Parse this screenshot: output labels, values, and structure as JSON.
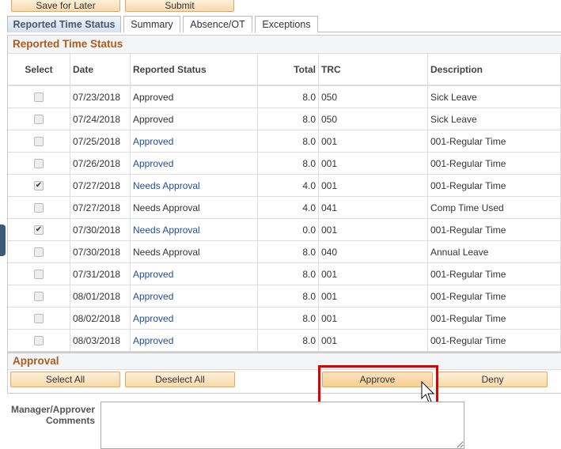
{
  "top_buttons": {
    "save": "Save for Later",
    "submit": "Submit"
  },
  "tabs": [
    {
      "label": "Reported Time Status",
      "active": true
    },
    {
      "label": "Summary"
    },
    {
      "label": "Absence/OT"
    },
    {
      "label": "Exceptions"
    }
  ],
  "grid": {
    "title": "Reported Time Status",
    "columns": [
      "Select",
      "Date",
      "Reported Status",
      "Total",
      "TRC",
      "Description"
    ],
    "rows": [
      {
        "checked": false,
        "date": "07/23/2018",
        "status": "Approved",
        "link": false,
        "total": "8.0",
        "trc": "050",
        "desc": "Sick Leave"
      },
      {
        "checked": false,
        "date": "07/24/2018",
        "status": "Approved",
        "link": false,
        "total": "8.0",
        "trc": "050",
        "desc": "Sick Leave"
      },
      {
        "checked": false,
        "date": "07/25/2018",
        "status": "Approved",
        "link": true,
        "total": "8.0",
        "trc": "001",
        "desc": "001-Regular Time"
      },
      {
        "checked": false,
        "date": "07/26/2018",
        "status": "Approved",
        "link": true,
        "total": "8.0",
        "trc": "001",
        "desc": "001-Regular Time"
      },
      {
        "checked": true,
        "date": "07/27/2018",
        "status": "Needs Approval",
        "link": true,
        "total": "4.0",
        "trc": "001",
        "desc": "001-Regular Time"
      },
      {
        "checked": false,
        "date": "07/27/2018",
        "status": "Needs Approval",
        "link": false,
        "total": "4.0",
        "trc": "041",
        "desc": "Comp Time Used"
      },
      {
        "checked": true,
        "date": "07/30/2018",
        "status": "Needs Approval",
        "link": true,
        "total": "0.0",
        "trc": "001",
        "desc": "001-Regular Time"
      },
      {
        "checked": false,
        "date": "07/30/2018",
        "status": "Needs Approval",
        "link": false,
        "total": "8.0",
        "trc": "040",
        "desc": "Annual Leave"
      },
      {
        "checked": false,
        "date": "07/31/2018",
        "status": "Approved",
        "link": true,
        "total": "8.0",
        "trc": "001",
        "desc": "001-Regular Time"
      },
      {
        "checked": false,
        "date": "08/01/2018",
        "status": "Approved",
        "link": true,
        "total": "8.0",
        "trc": "001",
        "desc": "001-Regular Time"
      },
      {
        "checked": false,
        "date": "08/02/2018",
        "status": "Approved",
        "link": true,
        "total": "8.0",
        "trc": "001",
        "desc": "001-Regular Time"
      },
      {
        "checked": false,
        "date": "08/03/2018",
        "status": "Approved",
        "link": true,
        "total": "8.0",
        "trc": "001",
        "desc": "001-Regular Time"
      }
    ]
  },
  "approval": {
    "title": "Approval",
    "select_all": "Select All",
    "deselect_all": "Deselect All",
    "approve": "Approve",
    "deny": "Deny"
  },
  "comments": {
    "label1": "Manager/Approver",
    "label2": "Comments",
    "value": ""
  },
  "colors": {
    "highlight": "#e00000",
    "section_title": "#b05a1c",
    "link": "#1f4fa0"
  }
}
